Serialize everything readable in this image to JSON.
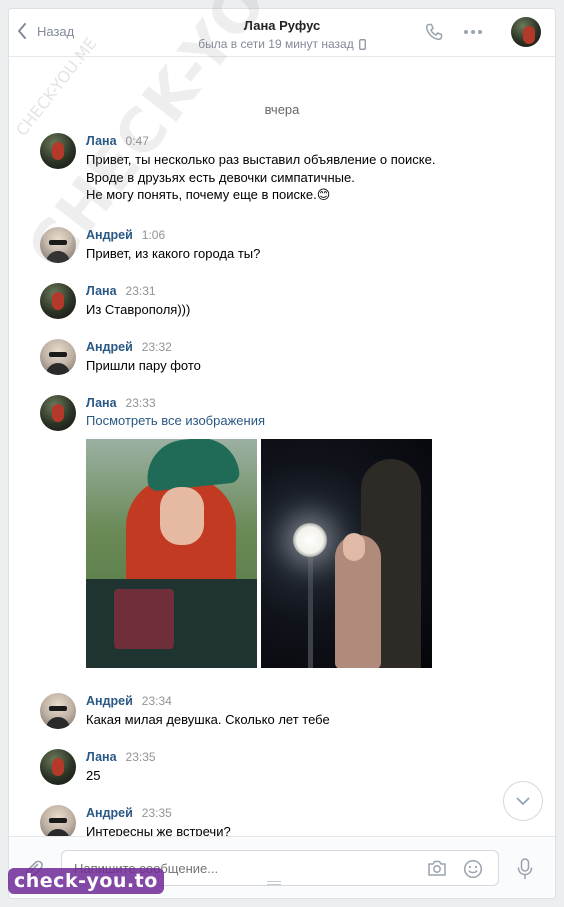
{
  "header": {
    "back_label": "Назад",
    "contact_name": "Лана Руфус",
    "status": "была в сети 19 минут назад"
  },
  "feed": {
    "day_separator": "вчера",
    "messages": [
      {
        "author": "Лана",
        "time": "0:47",
        "lines": [
          "Привет, ты несколько раз выставил объявление о поиске.",
          "Вроде в друзьях есть девочки симпатичные.",
          "Не могу понять, почему еще в поиске.😊"
        ]
      },
      {
        "author": "Андрей",
        "time": "1:06",
        "lines": [
          "Привет, из какого города ты?"
        ]
      },
      {
        "author": "Лана",
        "time": "23:31",
        "lines": [
          "Из Ставрополя)))"
        ]
      },
      {
        "author": "Андрей",
        "time": "23:32",
        "lines": [
          "Пришли пару фото"
        ]
      },
      {
        "author": "Лана",
        "time": "23:33",
        "link": "Посмотреть все изображения"
      },
      {
        "author": "Андрей",
        "time": "23:34",
        "lines": [
          "Какая милая девушка. Сколько лет тебе"
        ]
      },
      {
        "author": "Лана",
        "time": "23:35",
        "lines": [
          "25"
        ]
      },
      {
        "author": "Андрей",
        "time": "23:35",
        "lines": [
          "Интересны же встречи?"
        ]
      }
    ]
  },
  "composer": {
    "placeholder": "Напишите сообщение..."
  },
  "watermarks": {
    "big": "CHECK-YOU.ME",
    "small": "CHECK-YOU.ME",
    "brand": "check-you.to"
  },
  "icons": {
    "back": "chevron-left-icon",
    "call": "phone-icon",
    "more": "more-dots-icon",
    "attach": "paperclip-icon",
    "camera": "camera-icon",
    "emoji": "smile-icon",
    "voice": "microphone-icon",
    "scroll": "chevron-down-icon"
  },
  "colors": {
    "link": "#2a5885",
    "muted": "#828a99",
    "background": "#edeef0"
  }
}
